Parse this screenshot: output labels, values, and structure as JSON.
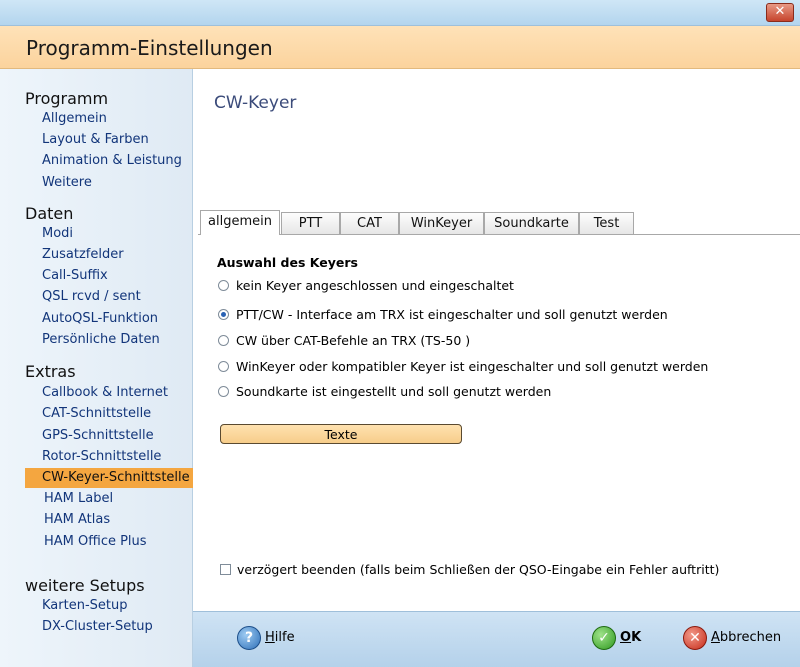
{
  "window": {
    "close_label": "✕"
  },
  "header": {
    "title": "Programm-Einstellungen"
  },
  "sidebar": {
    "groups": [
      {
        "title": "Programm",
        "items": [
          "Allgemein",
          "Layout & Farben",
          "Animation & Leistung",
          "Weitere"
        ]
      },
      {
        "title": "Daten",
        "items": [
          "Modi",
          "Zusatzfelder",
          "Call-Suffix",
          "QSL rcvd / sent",
          "AutoQSL-Funktion",
          "Persönliche Daten"
        ]
      },
      {
        "title": "Extras",
        "items": [
          "Callbook & Internet",
          "CAT-Schnittstelle",
          "GPS-Schnittstelle",
          "Rotor-Schnittstelle",
          "CW-Keyer-Schnittstelle",
          "HAM Label",
          "HAM Atlas",
          "HAM Office Plus"
        ]
      },
      {
        "title": "weitere Setups",
        "items": [
          "Karten-Setup",
          "DX-Cluster-Setup"
        ]
      }
    ],
    "selected": "CW-Keyer-Schnittstelle"
  },
  "main": {
    "title": "CW-Keyer",
    "tabs": [
      "allgemein",
      "PTT",
      "CAT",
      "WinKeyer",
      "Soundkarte",
      "Test"
    ],
    "active_tab": "allgemein",
    "section_title": "Auswahl des Keyers",
    "options": [
      "kein Keyer angeschlossen und eingeschaltet",
      "PTT/CW - Interface am TRX ist eingeschalter und soll genutzt werden",
      "CW über CAT-Befehle an TRX (TS-50 )",
      "WinKeyer oder kompatibler Keyer ist eingeschalter und soll genutzt werden",
      "Soundkarte ist eingestellt und soll genutzt werden"
    ],
    "selected_option": 1,
    "texte_button": "Texte",
    "delay_checkbox_label": "verzögert beenden (falls beim Schließen der QSO-Eingabe ein Fehler auftritt)",
    "delay_checked": false
  },
  "footer": {
    "help": {
      "underlined": "H",
      "rest": "ilfe"
    },
    "ok": {
      "underlined": "O",
      "rest": "K"
    },
    "cancel": {
      "underlined": "A",
      "rest": "bbrechen"
    }
  },
  "colors": {
    "selected": "#f4a640",
    "header": "#fbd39d",
    "footer": "#b4d1ea"
  }
}
